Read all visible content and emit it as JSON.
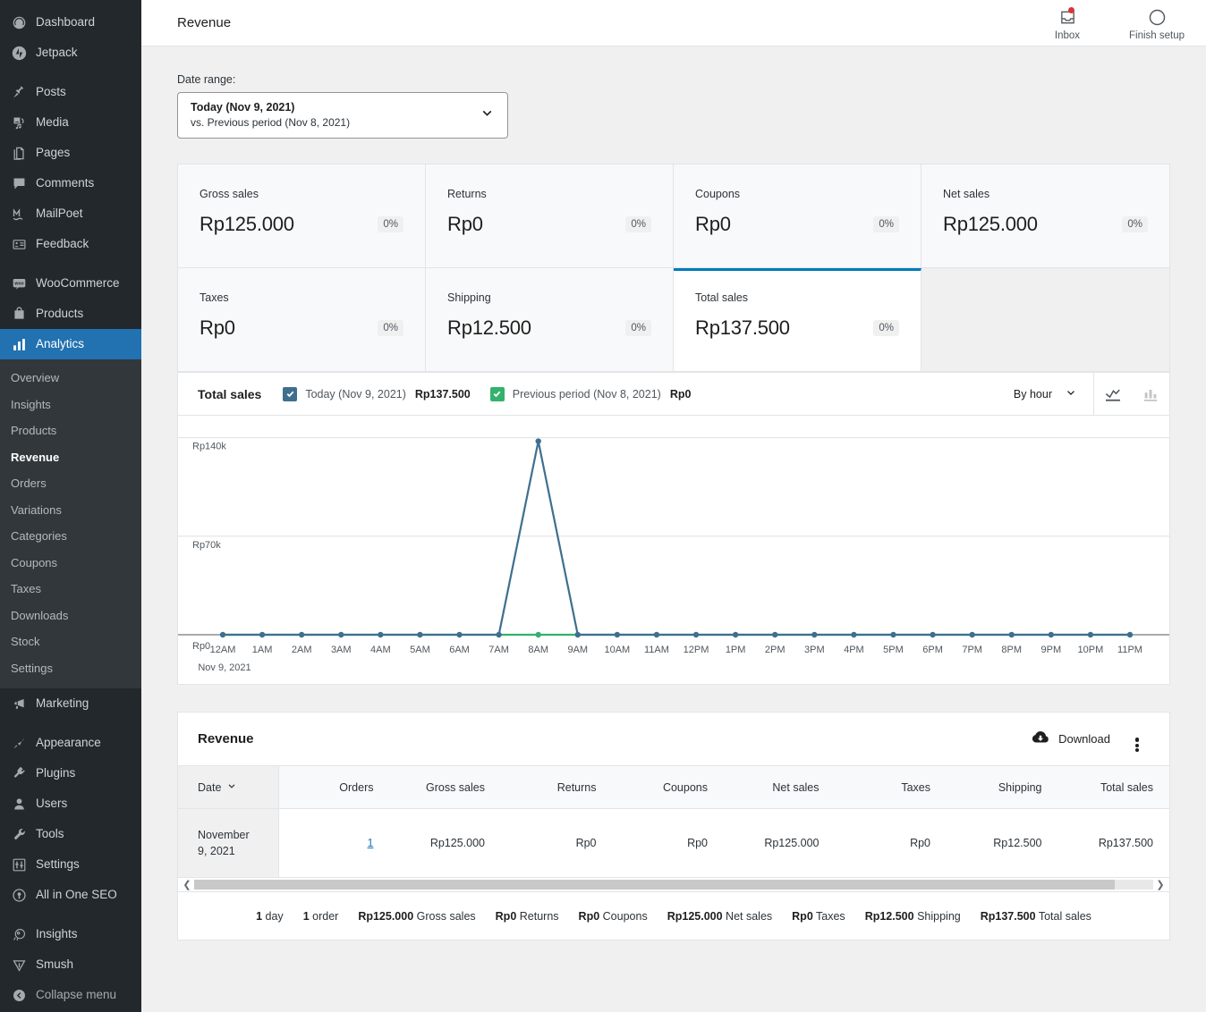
{
  "sidebar": {
    "items": [
      {
        "label": "Dashboard",
        "icon": "dashboard-icon"
      },
      {
        "label": "Jetpack",
        "icon": "jetpack-icon"
      },
      {
        "label": "Posts",
        "icon": "pin-icon"
      },
      {
        "label": "Media",
        "icon": "media-icon"
      },
      {
        "label": "Pages",
        "icon": "pages-icon"
      },
      {
        "label": "Comments",
        "icon": "comments-icon"
      },
      {
        "label": "MailPoet",
        "icon": "mailpoet-icon"
      },
      {
        "label": "Feedback",
        "icon": "feedback-icon"
      },
      {
        "label": "WooCommerce",
        "icon": "woocommerce-icon"
      },
      {
        "label": "Products",
        "icon": "products-icon"
      },
      {
        "label": "Analytics",
        "icon": "analytics-icon"
      },
      {
        "label": "Marketing",
        "icon": "marketing-icon"
      },
      {
        "label": "Appearance",
        "icon": "appearance-icon"
      },
      {
        "label": "Plugins",
        "icon": "plugins-icon"
      },
      {
        "label": "Users",
        "icon": "users-icon"
      },
      {
        "label": "Tools",
        "icon": "tools-icon"
      },
      {
        "label": "Settings",
        "icon": "settings-icon"
      },
      {
        "label": "All in One SEO",
        "icon": "aioseo-icon"
      },
      {
        "label": "Insights",
        "icon": "monsterinsights-icon"
      },
      {
        "label": "Smush",
        "icon": "smush-icon"
      },
      {
        "label": "Collapse menu",
        "icon": "collapse-icon"
      }
    ],
    "submenu": [
      "Overview",
      "Insights",
      "Products",
      "Revenue",
      "Orders",
      "Variations",
      "Categories",
      "Coupons",
      "Taxes",
      "Downloads",
      "Stock",
      "Settings"
    ],
    "active_item": "Analytics",
    "active_subitem": "Revenue",
    "accent": "#2271b1"
  },
  "header": {
    "title": "Revenue",
    "inbox_label": "Inbox",
    "finish_setup_label": "Finish setup",
    "badge_color": "#d63638"
  },
  "date_range": {
    "label": "Date range:",
    "primary": "Today (Nov 9, 2021)",
    "secondary": "vs. Previous period (Nov 8, 2021)"
  },
  "summary_cards": [
    {
      "label": "Gross sales",
      "value": "Rp125.000",
      "delta": "0%",
      "selected": false
    },
    {
      "label": "Returns",
      "value": "Rp0",
      "delta": "0%",
      "selected": false
    },
    {
      "label": "Coupons",
      "value": "Rp0",
      "delta": "0%",
      "selected": false
    },
    {
      "label": "Net sales",
      "value": "Rp125.000",
      "delta": "0%",
      "selected": false
    },
    {
      "label": "Taxes",
      "value": "Rp0",
      "delta": "0%",
      "selected": false
    },
    {
      "label": "Shipping",
      "value": "Rp12.500",
      "delta": "0%",
      "selected": false
    },
    {
      "label": "Total sales",
      "value": "Rp137.500",
      "delta": "0%",
      "selected": true
    }
  ],
  "chart_panel": {
    "title": "Total sales",
    "legend": [
      {
        "label": "Today (Nov 9, 2021)",
        "value": "Rp137.500",
        "color": "#3f6f8f",
        "checked": true
      },
      {
        "label": "Previous period (Nov 8, 2021)",
        "value": "Rp0",
        "color": "#33b26e",
        "checked": true
      }
    ],
    "interval_label": "By hour",
    "chart_type_line": "line-chart-icon",
    "chart_type_bar": "bar-chart-icon",
    "active_chart_type": "line"
  },
  "chart_data": {
    "type": "line",
    "title": "Total sales",
    "xlabel": "Nov 9, 2021",
    "ylabel": "",
    "x_axis_caption": "Nov 9, 2021",
    "categories": [
      "12AM",
      "1AM",
      "2AM",
      "3AM",
      "4AM",
      "5AM",
      "6AM",
      "7AM",
      "8AM",
      "9AM",
      "10AM",
      "11AM",
      "12PM",
      "1PM",
      "2PM",
      "3PM",
      "4PM",
      "5PM",
      "6PM",
      "7PM",
      "8PM",
      "9PM",
      "10PM",
      "11PM"
    ],
    "ytick_labels": [
      "Rp0",
      "Rp70k",
      "Rp140k"
    ],
    "ytick_values": [
      0,
      70000,
      140000
    ],
    "ylim": [
      0,
      148000
    ],
    "grid": true,
    "legend_position": "top",
    "series": [
      {
        "name": "Today (Nov 9, 2021)",
        "color": "#3f6f8f",
        "values": [
          0,
          0,
          0,
          0,
          0,
          0,
          0,
          0,
          137500,
          0,
          0,
          0,
          0,
          0,
          0,
          0,
          0,
          0,
          0,
          0,
          0,
          0,
          0,
          0
        ]
      },
      {
        "name": "Previous period (Nov 8, 2021)",
        "color": "#33b26e",
        "values": [
          0,
          0,
          0,
          0,
          0,
          0,
          0,
          0,
          0,
          0,
          0,
          0,
          0,
          0,
          0,
          0,
          0,
          0,
          0,
          0,
          0,
          0,
          0,
          0
        ]
      }
    ]
  },
  "table": {
    "title": "Revenue",
    "download_label": "Download",
    "download_icon": "cloud-download-icon",
    "menu_icon": "kebab-menu-icon",
    "columns": [
      "Date",
      "Orders",
      "Gross sales",
      "Returns",
      "Coupons",
      "Net sales",
      "Taxes",
      "Shipping",
      "Total sales"
    ],
    "sort_column": "Date",
    "rows": [
      {
        "date": "November 9, 2021",
        "orders": "1",
        "gross_sales": "Rp125.000",
        "returns": "Rp0",
        "coupons": "Rp0",
        "net_sales": "Rp125.000",
        "taxes": "Rp0",
        "shipping": "Rp12.500",
        "total_sales": "Rp137.500"
      }
    ],
    "summary": [
      {
        "value": "1",
        "label": "day"
      },
      {
        "value": "1",
        "label": "order"
      },
      {
        "value": "Rp125.000",
        "label": "Gross sales"
      },
      {
        "value": "Rp0",
        "label": "Returns"
      },
      {
        "value": "Rp0",
        "label": "Coupons"
      },
      {
        "value": "Rp125.000",
        "label": "Net sales"
      },
      {
        "value": "Rp0",
        "label": "Taxes"
      },
      {
        "value": "Rp12.500",
        "label": "Shipping"
      },
      {
        "value": "Rp137.500",
        "label": "Total sales"
      }
    ]
  }
}
